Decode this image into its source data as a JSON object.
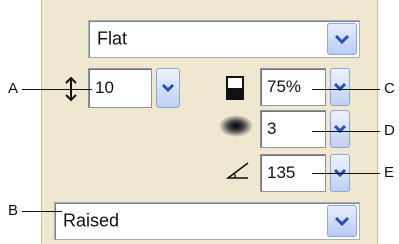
{
  "style_dropdown": {
    "value": "Flat"
  },
  "height": {
    "value": "10"
  },
  "opacity": {
    "value": "75%"
  },
  "softness": {
    "value": "3"
  },
  "angle": {
    "value": "135"
  },
  "bevel_dropdown": {
    "value": "Raised"
  },
  "callouts": {
    "a": "A",
    "b": "B",
    "c": "C",
    "d": "D",
    "e": "E"
  },
  "icons": [
    "up-down-arrow-icon",
    "opacity-icon",
    "softness-icon",
    "angle-icon",
    "chevron-down-icon"
  ]
}
